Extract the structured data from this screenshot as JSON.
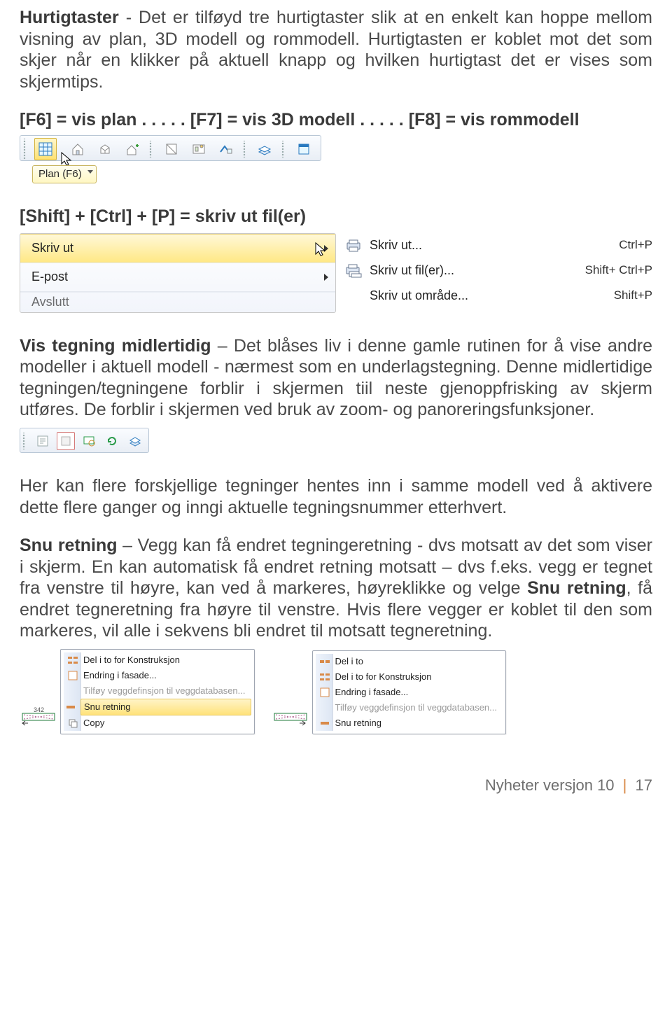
{
  "para1": {
    "title": "Hurtigtaster",
    "body": " - Det er tilføyd tre hurtigtaster slik at en enkelt kan hoppe mellom visning av plan, 3D modell og rommodell. Hurtigtasten er koblet mot det som skjer når en klikker på aktuell knapp og hvilken hurtigtast det er vises som skjermtips."
  },
  "shortcuts_line": "[F6] = vis plan . . . . . [F7] = vis 3D modell . . . . . [F8] = vis rommodell",
  "tooltip1": "Plan (F6)",
  "print_line": "[Shift] + [Ctrl] + [P] = skriv ut fil(er)",
  "menu_left": {
    "items": [
      {
        "label": "Skriv ut"
      },
      {
        "label": "E-post"
      },
      {
        "label": "Avslutt"
      }
    ]
  },
  "menu_right": {
    "items": [
      {
        "label": "Skriv ut...",
        "shortcut": "Ctrl+P"
      },
      {
        "label": "Skriv ut fil(er)...",
        "shortcut": "Shift+ Ctrl+P"
      },
      {
        "label": "Skriv ut område...",
        "shortcut": "Shift+P"
      }
    ]
  },
  "para2": {
    "title": "Vis tegning midlertidig",
    "body": " – Det blåses liv i denne gamle rutinen for å vise andre modeller i aktuell modell - nærmest som en underlagstegning. Denne midlertidige tegningen/tegningene forblir i skjermen tiil neste gjenoppfrisking av skjerm utføres. De forblir i skjermen ved bruk av zoom- og panoreringsfunksjoner."
  },
  "para3": "Her kan flere forskjellige tegninger hentes inn i samme modell ved å aktivere dette flere ganger og inngi aktuelle tegningsnummer etterhvert.",
  "para4": {
    "title": "Snu retning",
    "body_a": " – Vegg kan få endret tegningeretning - dvs motsatt av det som viser i skjerm. En kan automatisk få endret retning motsatt – dvs f.eks. vegg er tegnet fra venstre til høyre, kan ved å markeres, høyreklikke og velge ",
    "bold": "Snu retning",
    "body_b": ", få endret tegneretning fra høyre til venstre. Hvis flere vegger er koblet til den som markeres, vil alle i sekvens bli endret til motsatt tegneretning."
  },
  "ctx_left": {
    "items": [
      {
        "label": "Del i to for Konstruksjon",
        "icon": "split"
      },
      {
        "label": "Endring i fasade...",
        "icon": "facade"
      },
      {
        "label": "Tilføy veggdefinsjon til veggdatabasen...",
        "icon": "db",
        "disabled": true
      },
      {
        "label": "Snu retning",
        "icon": "flip",
        "selected": true
      },
      {
        "label": "Copy",
        "icon": "copy"
      }
    ]
  },
  "ctx_right": {
    "items": [
      {
        "label": "Del i to",
        "icon": "split"
      },
      {
        "label": "Del i to for Konstruksjon",
        "icon": "split"
      },
      {
        "label": "Endring i fasade...",
        "icon": "facade"
      },
      {
        "label": "Tilføy veggdefinsjon til veggdatabasen...",
        "icon": "db",
        "disabled": true
      },
      {
        "label": "Snu retning",
        "icon": "flip"
      }
    ]
  },
  "footer": {
    "left": "Nyheter versjon 10",
    "right": "17"
  }
}
